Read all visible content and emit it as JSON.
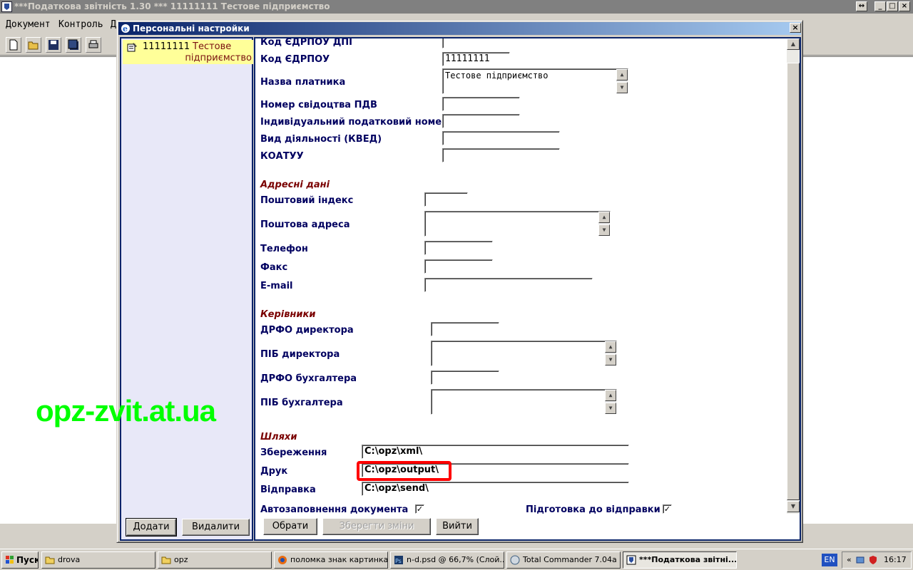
{
  "main": {
    "title": "***Податкова звітність 1.30 *** 11111111 Тестове підприємство",
    "menu": [
      "Документ",
      "Контроль",
      "Д"
    ]
  },
  "dialog": {
    "title": "Персональні настройки",
    "tree": {
      "code": "11111111",
      "name_line1": "Тестове",
      "name_line2": "підприємство"
    },
    "left_buttons": {
      "add": "Додати",
      "delete": "Видалити"
    },
    "fields": {
      "kod_dpi_label": "Код ЄДРПОУ ДПІ",
      "kod_label": "Код ЄДРПОУ",
      "kod_value": "11111111",
      "name_label": "Назва платника",
      "name_value": "Тестове підприємство",
      "pdv_label": "Номер свідоцтва ПДВ",
      "ipn_label": "Індивідуальний податковий номер",
      "kved_label": "Вид діяльності (КВЕД)",
      "koatuu_label": "КОАТУУ"
    },
    "address": {
      "section": "Адресні дані",
      "zip_label": "Поштовий індекс",
      "addr_label": "Поштова адреса",
      "phone_label": "Телефон",
      "fax_label": "Факс",
      "email_label": "E-mail"
    },
    "managers": {
      "section": "Керівники",
      "drfo_dir_label": "ДРФО директора",
      "pib_dir_label": "ПІБ директора",
      "drfo_acc_label": "ДРФО бухгалтера",
      "pib_acc_label": "ПІБ бухгалтера"
    },
    "paths": {
      "section": "Шляхи",
      "save_label": "Збереження",
      "save_value": "C:\\opz\\xml\\",
      "print_label": "Друк",
      "print_value": "C:\\opz\\output\\",
      "send_label": "Відправка",
      "send_value": "C:\\opz\\send\\"
    },
    "options": {
      "autofill_label": "Автозаповнення документа",
      "autofill_checked": "✓",
      "prepare_label": "Підготовка до відправки",
      "prepare_checked": "✓"
    },
    "buttons": {
      "choose": "Обрати",
      "save": "Зберегти зміни",
      "exit": "Вийти"
    }
  },
  "watermark": "opz-zvit.at.ua",
  "taskbar": {
    "start": "Пуск",
    "tasks": [
      "drova",
      "opz",
      "поломка знак картинка...",
      "n-d.psd @ 66,7% (Слой...",
      "Total Commander 7.04a ...",
      "***Податкова звітні..."
    ],
    "lang": "EN",
    "chevron": "«",
    "time": "16:17"
  },
  "colors": {
    "title_active": "#0a246a",
    "tree_selected": "#ffff99",
    "label": "#000060",
    "section": "#7a0000",
    "highlight": "#ff0000",
    "watermark": "#00ff00"
  }
}
